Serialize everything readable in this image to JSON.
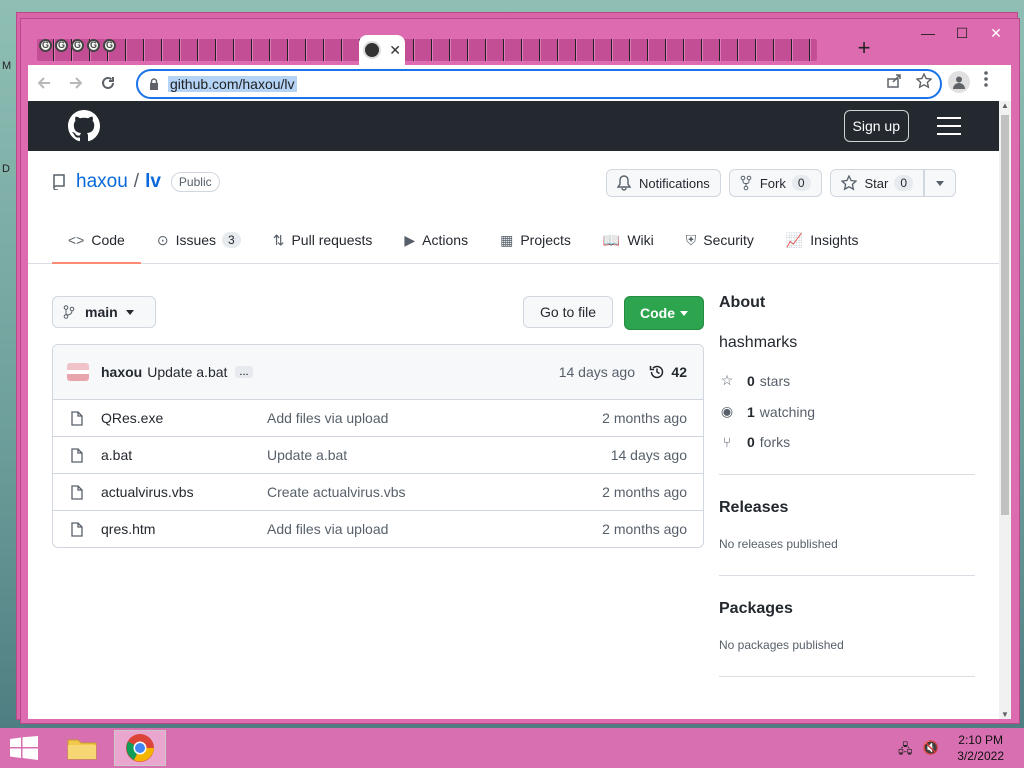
{
  "desktop": {
    "left_letters": [
      "M",
      "D"
    ]
  },
  "browser": {
    "url": "github.com/haxou/lv",
    "window_controls": [
      "—",
      "☐",
      "✕"
    ],
    "tab_close": "✕",
    "new_tab": "+",
    "mini_tab_glyph": "G"
  },
  "github": {
    "signup": "Sign up",
    "owner": "haxou",
    "separator": "/",
    "repo": "lv",
    "visibility": "Public",
    "notifications": "Notifications",
    "fork_label": "Fork",
    "fork_count": "0",
    "star_label": "Star",
    "star_count": "0",
    "tabs": [
      {
        "label": "Code",
        "icon": "<>"
      },
      {
        "label": "Issues",
        "icon": "⊙",
        "count": "3"
      },
      {
        "label": "Pull requests",
        "icon": "⇅"
      },
      {
        "label": "Actions",
        "icon": "▶"
      },
      {
        "label": "Projects",
        "icon": "▦"
      },
      {
        "label": "Wiki",
        "icon": "📖"
      },
      {
        "label": "Security",
        "icon": "⛨"
      },
      {
        "label": "Insights",
        "icon": "📈"
      }
    ],
    "branch": "main",
    "go_to_file": "Go to file",
    "code_button": "Code",
    "latest_commit": {
      "author": "haxou",
      "message": "Update a.bat",
      "ellipsis": "...",
      "time": "14 days ago",
      "count": "42"
    },
    "files": [
      {
        "name": "QRes.exe",
        "commit": "Add files via upload",
        "time": "2 months ago"
      },
      {
        "name": "a.bat",
        "commit": "Update a.bat",
        "time": "14 days ago"
      },
      {
        "name": "actualvirus.vbs",
        "commit": "Create actualvirus.vbs",
        "time": "2 months ago"
      },
      {
        "name": "qres.htm",
        "commit": "Add files via upload",
        "time": "2 months ago"
      }
    ],
    "about": {
      "title": "About",
      "description": "hashmarks",
      "stars_count": "0",
      "stars_label": "stars",
      "watching_count": "1",
      "watching_label": "watching",
      "forks_count": "0",
      "forks_label": "forks"
    },
    "releases": {
      "title": "Releases",
      "text": "No releases published"
    },
    "packages": {
      "title": "Packages",
      "text": "No packages published"
    }
  },
  "taskbar": {
    "time": "2:10 PM",
    "date": "3/2/2022"
  },
  "colors": {
    "window_frame": "#dd6bb0",
    "github_header": "#24292f",
    "code_button": "#2da44e",
    "link": "#0969da",
    "tab_underline": "#fd8c73"
  }
}
